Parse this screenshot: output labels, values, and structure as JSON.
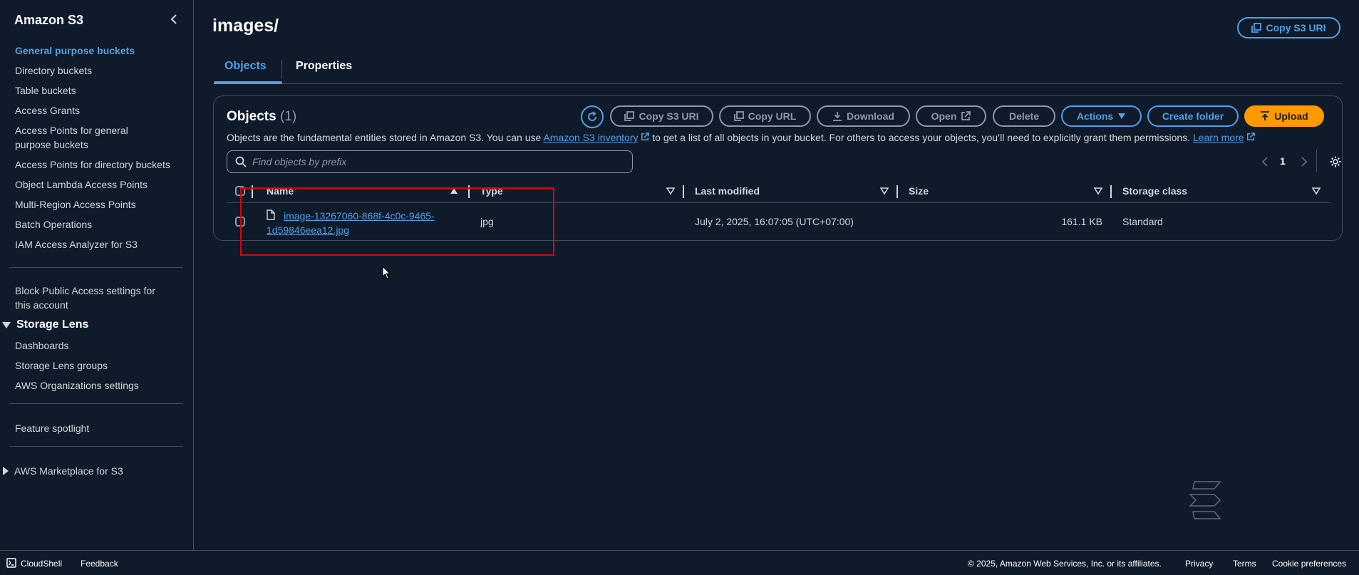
{
  "sidebar": {
    "title": "Amazon S3",
    "items": [
      "General purpose buckets",
      "Directory buckets",
      "Table buckets",
      "Access Grants",
      "Access Points for general purpose buckets",
      "Access Points for directory buckets",
      "Object Lambda Access Points",
      "Multi-Region Access Points",
      "Batch Operations",
      "IAM Access Analyzer for S3"
    ],
    "block_public": "Block Public Access settings for this account",
    "storage_lens": {
      "label": "Storage Lens",
      "items": [
        "Dashboards",
        "Storage Lens groups",
        "AWS Organizations settings"
      ]
    },
    "feature_spotlight": "Feature spotlight",
    "marketplace": "AWS Marketplace for S3"
  },
  "header": {
    "title": "images/",
    "copy_uri": "Copy S3 URI"
  },
  "tabs": [
    "Objects",
    "Properties"
  ],
  "objects_panel": {
    "title": "Objects",
    "count": "(1)",
    "desc_1": "Objects are the fundamental entities stored in Amazon S3. You can use ",
    "desc_link": "Amazon S3 inventory",
    "desc_2": " to get a list of all objects in your bucket. For others to access your objects, you’ll need to explicitly grant them permissions. ",
    "learn_more": "Learn more",
    "toolbar": {
      "copy_uri": "Copy S3 URI",
      "copy_url": "Copy URL",
      "download": "Download",
      "open": "Open",
      "delete": "Delete",
      "actions": "Actions",
      "create_folder": "Create folder",
      "upload": "Upload"
    },
    "search_placeholder": "Find objects by prefix",
    "page": "1",
    "columns": [
      "Name",
      "Type",
      "Last modified",
      "Size",
      "Storage class"
    ],
    "rows": [
      {
        "name_1": "image-13267060-868f-4c0c-9465-",
        "name_2": "1d59846eea12.jpg",
        "type": "jpg",
        "modified": "July 2, 2025, 16:07:05 (UTC+07:00)",
        "size": "161.1 KB",
        "storage_class": "Standard"
      }
    ]
  },
  "footer": {
    "cloudshell": "CloudShell",
    "feedback": "Feedback",
    "copyright": "© 2025, Amazon Web Services, Inc. or its affiliates.",
    "privacy": "Privacy",
    "terms": "Terms",
    "cookies": "Cookie preferences"
  },
  "colors": {
    "accent": "#539fe5",
    "primary": "#ff9900",
    "background": "#0f1b2a",
    "highlight": "#e0000b"
  }
}
